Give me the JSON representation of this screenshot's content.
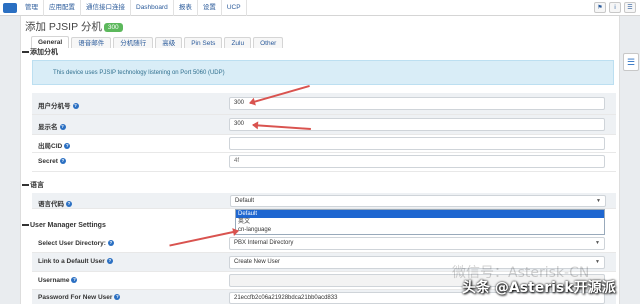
{
  "topnav": {
    "items": [
      "管理",
      "应用配置",
      "通信接口连接",
      "Dashboard",
      "报表",
      "设置",
      "UCP"
    ],
    "right_icons": [
      "flag-icon",
      "info-icon",
      "user-icon"
    ]
  },
  "page": {
    "title": "添加 PJSIP 分机",
    "badge": "300"
  },
  "tabs": [
    "General",
    "语音邮件",
    "分机随行",
    "高级",
    "Pin Sets",
    "Zulu",
    "Other"
  ],
  "sections": {
    "add_extension": "添加分机",
    "language": "语言",
    "user_manager": "User Manager Settings"
  },
  "info_message": "This device uses PJSIP technology listening on Port 5060 (UDP)",
  "fields": {
    "user_extension": {
      "label": "用户分机号",
      "value": "300"
    },
    "display_name": {
      "label": "显示名",
      "value": "300"
    },
    "outbound_cid": {
      "label": "出局CID",
      "value": ""
    },
    "secret": {
      "label": "Secret",
      "value": "4f"
    },
    "language_code": {
      "label": "语言代码",
      "value": "Default"
    },
    "select_user_directory": {
      "label": "Select User Directory:",
      "value": "PBX Internal Directory"
    },
    "link_default_user": {
      "label": "Link to a Default User",
      "value": "Create New User"
    },
    "username": {
      "label": "Username",
      "value": ""
    },
    "password_new_user": {
      "label": "Password For New User",
      "value": "21eccfb2c06a21928bdca21bb0acd833"
    }
  },
  "language_options": [
    "Default",
    "英文",
    "cn-language"
  ],
  "watermark": "微信号：Asterisk-CN",
  "credit": "头条 @Asterisk开源派",
  "colors": {
    "accent": "#2a6fc2",
    "badge": "#5cb85c",
    "highlight": "#1e66d0",
    "annotation": "#d9534f"
  }
}
